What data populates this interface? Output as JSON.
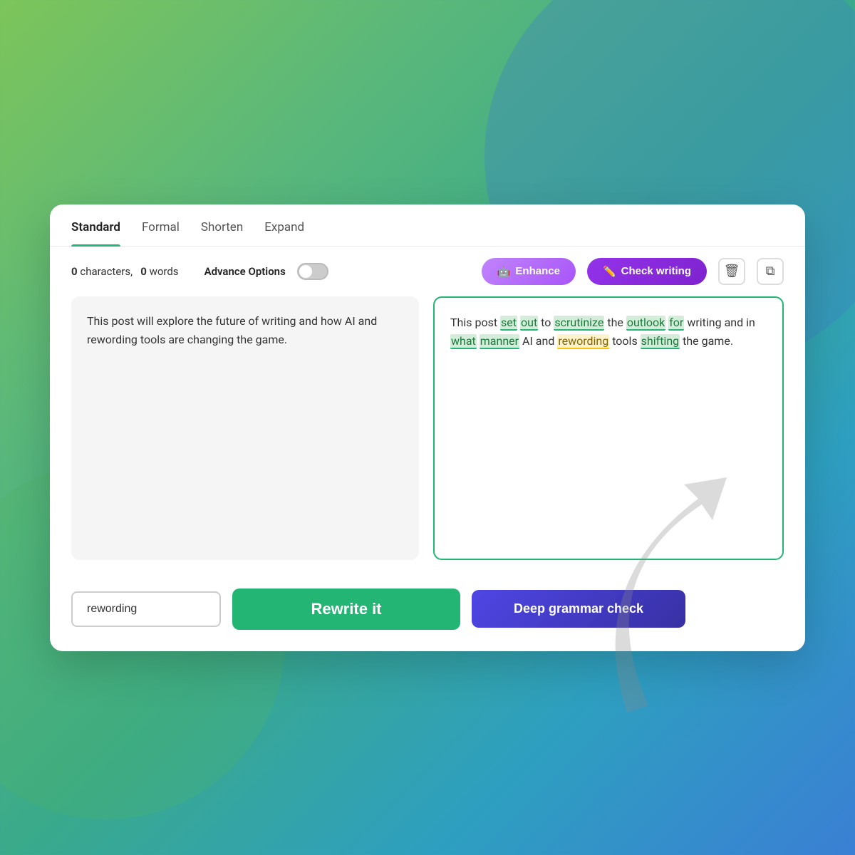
{
  "background": {
    "color_start": "#7dc55a",
    "color_end": "#3a7fd4"
  },
  "tabs": [
    {
      "id": "standard",
      "label": "Standard",
      "active": true
    },
    {
      "id": "formal",
      "label": "Formal",
      "active": false
    },
    {
      "id": "shorten",
      "label": "Shorten",
      "active": false
    },
    {
      "id": "expand",
      "label": "Expand",
      "active": false
    }
  ],
  "controls": {
    "characters_count": "0",
    "words_count": "0",
    "characters_label": "characters,",
    "words_label": "words",
    "advance_options_label": "Advance Options",
    "enhance_label": "Enhance",
    "check_writing_label": "Check writing",
    "enhance_icon": "🤖",
    "check_writing_icon": "✏️",
    "delete_icon": "🗑",
    "copy_icon": "⧉"
  },
  "input_text": "This post will explore the future of writing and how AI and rewording tools are changing the game.",
  "output": {
    "text_parts": [
      {
        "text": "This post ",
        "highlight": "none"
      },
      {
        "text": "set",
        "highlight": "green"
      },
      {
        "text": " ",
        "highlight": "none"
      },
      {
        "text": "out",
        "highlight": "green"
      },
      {
        "text": " to ",
        "highlight": "none"
      },
      {
        "text": "scrutinize",
        "highlight": "green"
      },
      {
        "text": " the ",
        "highlight": "none"
      },
      {
        "text": "outlook",
        "highlight": "green"
      },
      {
        "text": " ",
        "highlight": "none"
      },
      {
        "text": "for",
        "highlight": "green"
      },
      {
        "text": " writing and in ",
        "highlight": "none"
      },
      {
        "text": "what",
        "highlight": "green"
      },
      {
        "text": " ",
        "highlight": "none"
      },
      {
        "text": "manner",
        "highlight": "green"
      },
      {
        "text": " AI and ",
        "highlight": "none"
      },
      {
        "text": "rewording",
        "highlight": "yellow"
      },
      {
        "text": " tools ",
        "highlight": "none"
      },
      {
        "text": "shifting",
        "highlight": "green"
      },
      {
        "text": " the game.",
        "highlight": "none"
      }
    ]
  },
  "bottom": {
    "rewording_placeholder": "rewording",
    "rewrite_label": "Rewrite it",
    "grammar_label": "Deep grammar check"
  }
}
